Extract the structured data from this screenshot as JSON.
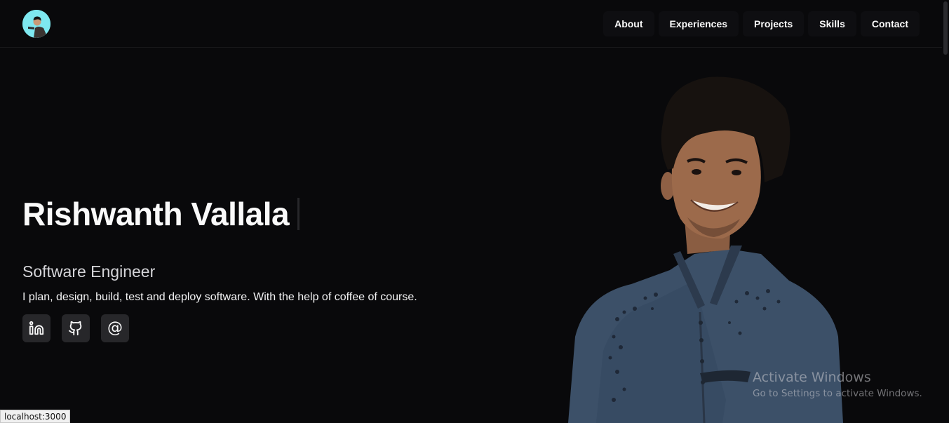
{
  "header": {
    "logo_icon": "avatar-logo",
    "nav": [
      {
        "label": "About"
      },
      {
        "label": "Experiences"
      },
      {
        "label": "Projects"
      },
      {
        "label": "Skills"
      },
      {
        "label": "Contact"
      }
    ]
  },
  "hero": {
    "name": "Rishwanth Vallala",
    "role": "Software Engineer",
    "description": "I plan, design, build, test and deploy software. With the help of coffee of course.",
    "socials": [
      {
        "icon": "linkedin-icon"
      },
      {
        "icon": "github-icon"
      },
      {
        "icon": "at-sign-icon",
        "glyph": "@"
      }
    ]
  },
  "watermark": {
    "title": "Activate Windows",
    "subtitle": "Go to Settings to activate Windows."
  },
  "status_bar": {
    "url": "localhost:3000"
  },
  "colors": {
    "background": "#09090b",
    "nav_button": "#0e0e11",
    "social_button": "#27272a",
    "text": "#fafafa",
    "logo_bg": "#7ee8f0"
  }
}
